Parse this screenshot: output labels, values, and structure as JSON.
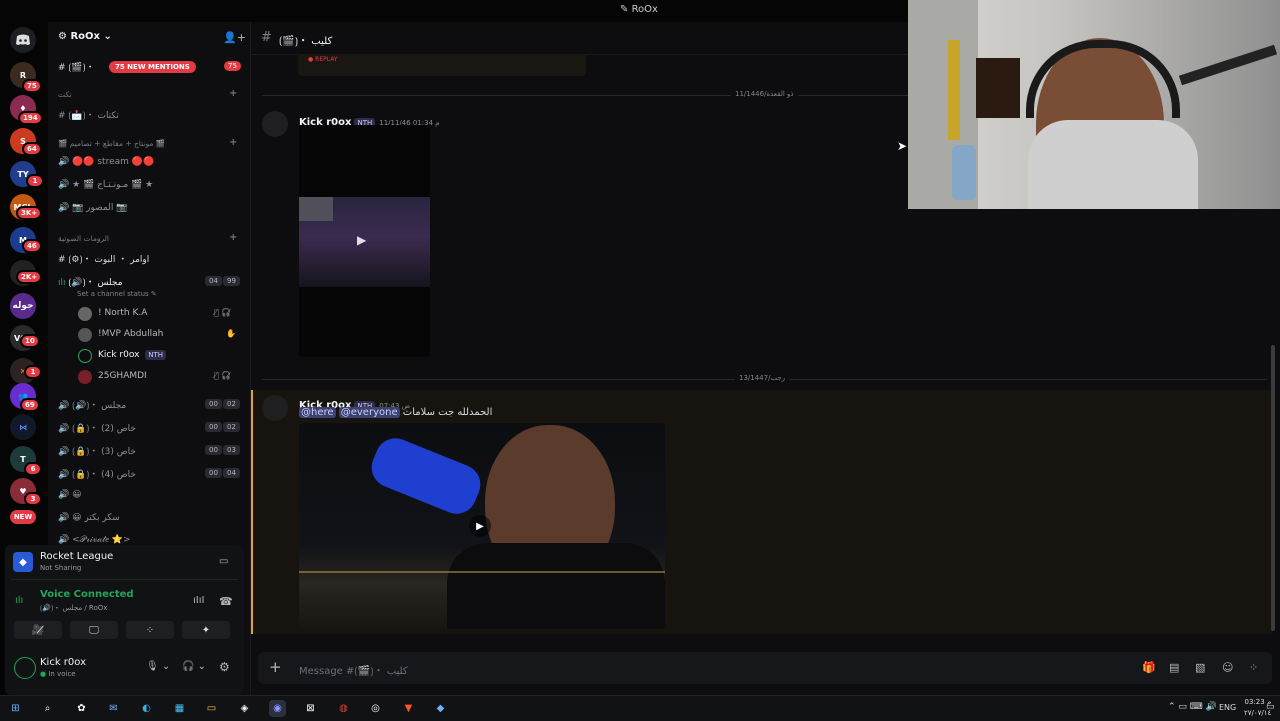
{
  "window": {
    "title": "RoOx"
  },
  "server": {
    "name": "RoOx"
  },
  "rail": {
    "badges": [
      "75",
      "194",
      "64",
      "1",
      "3K+",
      "46",
      "2K+",
      "10",
      "1",
      "69",
      "6",
      "3"
    ],
    "label_jawla": "جوله",
    "new_label": "NEW"
  },
  "sidebar": {
    "top_channel": "⟮🎬⟯・",
    "mentions_label": "75 NEW MENTIONS",
    "mentions_count": "75",
    "cat1": "تكت",
    "ticket_channel": "⟮📩⟯・ تكتات",
    "cat2": "🎬 مونتاج + مقاطع + تصاميم 🎬",
    "voice1": "🔴🔴 stream 🔴🔴",
    "voice2": "★ 🎬 مـونـتـاج 🎬 ★",
    "voice3": "📷 المصور 📷",
    "cat3": "الرومات الصوتية",
    "text_bot": "⟮⚙⟯・ اوامر ・ البوت",
    "voice_majlis": "⟮🔊⟯・ مجلس",
    "majlis_count_a": "04",
    "majlis_count_b": "99",
    "status_prompt": "Set a channel status ✎",
    "members": [
      "! North K.A",
      "!MVP Abdullah",
      "Kick r0ox",
      "25GHAMDI"
    ],
    "member_tag": "NTH",
    "voice_list": [
      {
        "name": "⟮🔊⟯・ مجلس",
        "a": "00",
        "b": "02"
      },
      {
        "name": "⟮🔒⟯・ خاص (2)",
        "a": "00",
        "b": "02"
      },
      {
        "name": "⟮🔒⟯・ خاص (3)",
        "a": "00",
        "b": "03"
      },
      {
        "name": "⟮🔒⟯・ خاص (4)",
        "a": "00",
        "b": "04"
      }
    ],
    "voice_smile": "😀",
    "voice_sakr": "😀 سكر بكتر",
    "voice_private": "<𝒫𝓇𝒾𝓋𝒶𝓉𝑒 ⭐>"
  },
  "panel": {
    "activity": "Rocket League",
    "activity_sub": "Not Sharing",
    "voice_status": "Voice Connected",
    "voice_channel": "⟮🔊⟯・ مجلس / RoOx",
    "user_name": "Kick r0ox",
    "user_status": "In voice"
  },
  "chat": {
    "channel_name": "⟮🎬⟯・ كليب",
    "date1": "ذو القعدة/11/1446",
    "date2": "رجب/13/1447",
    "msg1": {
      "author": "Kick r0ox",
      "tag": "NTH",
      "time": "11/11/46 01:34 م"
    },
    "msg2": {
      "author": "Kick r0ox",
      "tag": "NTH",
      "time": "07:43 ص",
      "mention1": "@here",
      "mention2": "@everyone",
      "text": "الحمدلله جت سلامات"
    },
    "replay_label": "REPLAY",
    "input_placeholder": "Message #⟮🎬⟯・ كليب"
  },
  "taskbar": {
    "lang": "ENG",
    "time": "03:23 م",
    "date": "٢٧/٠٧/١٤"
  },
  "colors": {
    "accent": "#5865f2",
    "danger": "#e23b44",
    "online": "#23a55a"
  }
}
